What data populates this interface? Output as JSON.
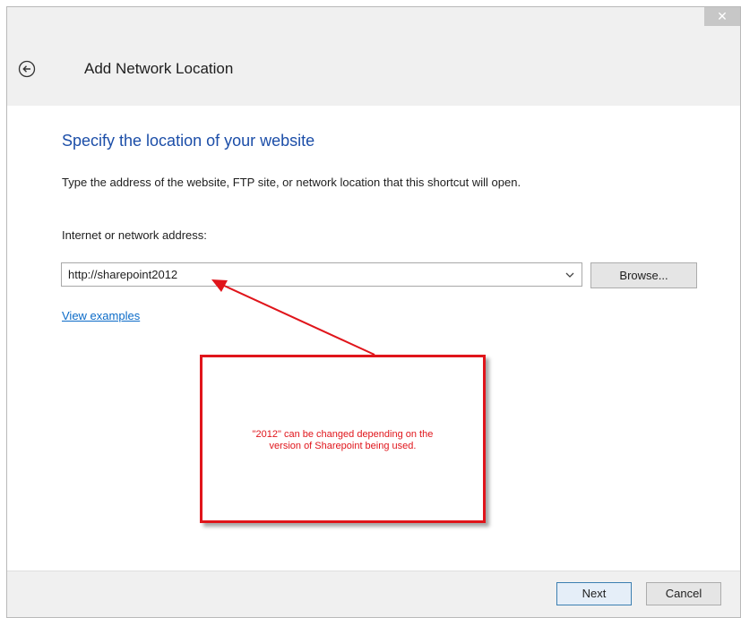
{
  "window": {
    "close_label": "✕",
    "header_title": "Add Network Location",
    "back_icon": "back-arrow-icon"
  },
  "main": {
    "section_title": "Specify the location of your website",
    "instructions": "Type the address of the website, FTP site, or network location that this shortcut will open.",
    "field_label": "Internet or network address:",
    "address_value": "http://sharepoint2012",
    "browse_label": "Browse...",
    "examples_link": "View examples"
  },
  "annotation": {
    "text": "\"2012\" can be changed depending on the\nversion of Sharepoint being used.",
    "color": "#e0151b"
  },
  "footer": {
    "next_label": "Next",
    "cancel_label": "Cancel"
  }
}
